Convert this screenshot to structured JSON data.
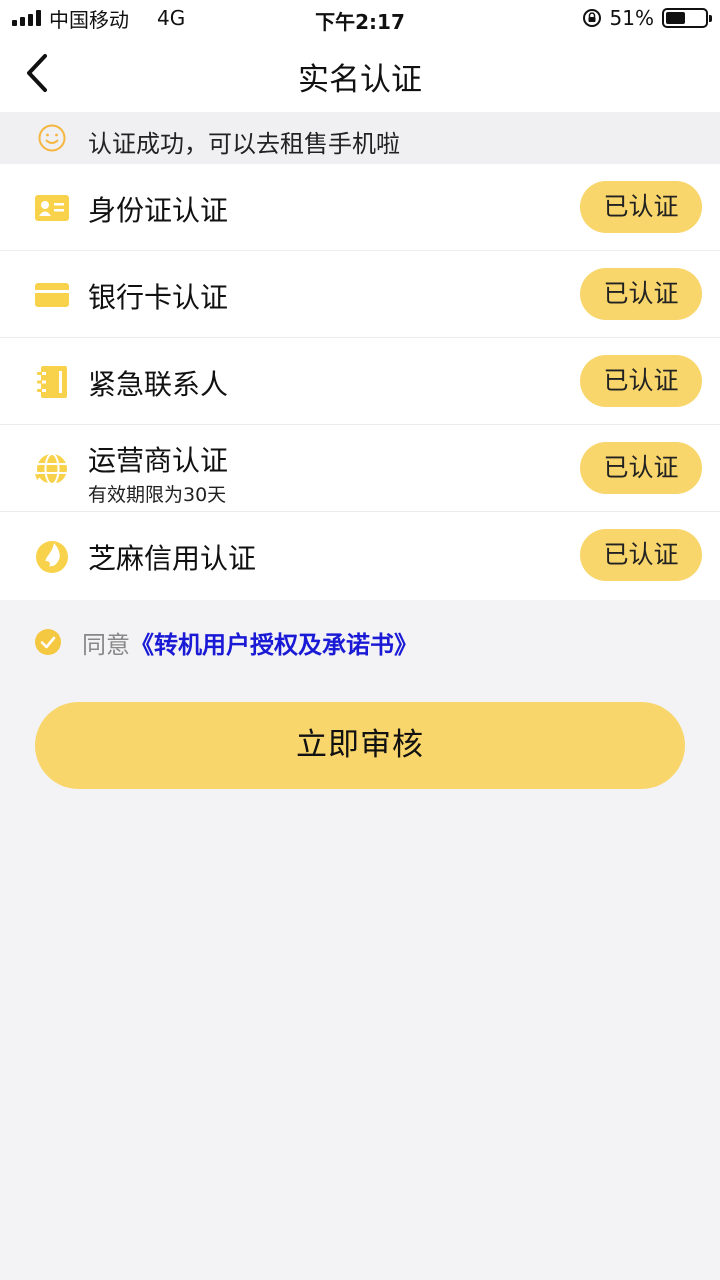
{
  "status_bar": {
    "carrier": "中国移动",
    "network": "4G",
    "time": "下午2:17",
    "battery": "51%",
    "battery_level": 0.51
  },
  "nav": {
    "title": "实名认证",
    "back_icon": "chevron-left-icon"
  },
  "notice": {
    "icon": "smile-icon",
    "text": "认证成功，可以去租售手机啦"
  },
  "verifications": [
    {
      "icon": "id-card-icon",
      "title": "身份证认证",
      "subtitle": "",
      "status": "已认证"
    },
    {
      "icon": "bank-card-icon",
      "title": "银行卡认证",
      "subtitle": "",
      "status": "已认证"
    },
    {
      "icon": "contact-book-icon",
      "title": "紧急联系人",
      "subtitle": "",
      "status": "已认证"
    },
    {
      "icon": "globe-icon",
      "title": "运营商认证",
      "subtitle": "有效期限为30天",
      "status": "已认证"
    },
    {
      "icon": "sesame-icon",
      "title": "芝麻信用认证",
      "subtitle": "",
      "status": "已认证"
    }
  ],
  "agreement": {
    "checked": true,
    "label": "同意",
    "link_text": "《转机用户授权及承诺书》"
  },
  "submit": {
    "label": "立即审核"
  },
  "colors": {
    "accent": "#f8d66b",
    "link": "#1a1ad6",
    "background": "#f3f3f5"
  }
}
